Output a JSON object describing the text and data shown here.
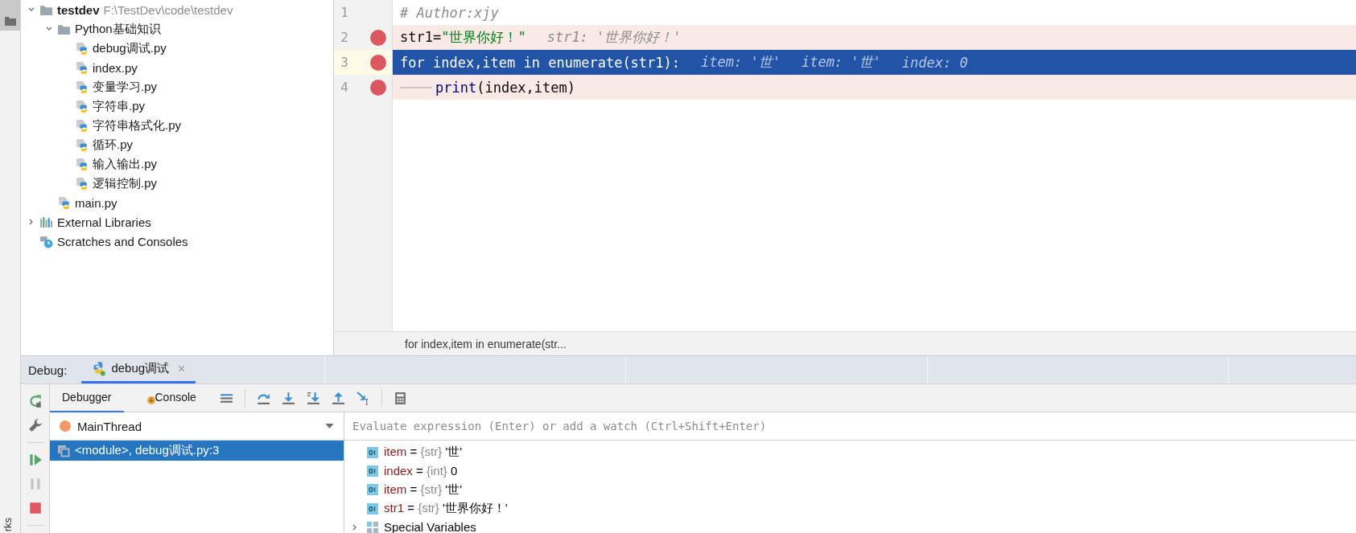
{
  "side_strip": {
    "label": "rks"
  },
  "project_tree": {
    "items": [
      {
        "label": "testdev",
        "path": "F:\\TestDev\\code\\testdev",
        "kind": "project",
        "expanded": true,
        "children": [
          {
            "label": "Python基础知识",
            "kind": "folder",
            "expanded": true,
            "children": [
              {
                "label": "debug调试.py",
                "kind": "file"
              },
              {
                "label": "index.py",
                "kind": "file"
              },
              {
                "label": "变量学习.py",
                "kind": "file"
              },
              {
                "label": "字符串.py",
                "kind": "file"
              },
              {
                "label": "字符串格式化.py",
                "kind": "file"
              },
              {
                "label": "循环.py",
                "kind": "file"
              },
              {
                "label": "输入输出.py",
                "kind": "file"
              },
              {
                "label": "逻辑控制.py",
                "kind": "file"
              }
            ]
          },
          {
            "label": "main.py",
            "kind": "file"
          }
        ]
      },
      {
        "label": "External Libraries",
        "kind": "libraries",
        "expanded": false
      },
      {
        "label": "Scratches and Consoles",
        "kind": "scratches"
      }
    ]
  },
  "editor": {
    "lines": [
      {
        "number": "1",
        "breakpoint": false,
        "current": false,
        "tokens": [
          {
            "text": "# Author:xjy",
            "kind": "comment"
          }
        ]
      },
      {
        "number": "2",
        "breakpoint": true,
        "current": false,
        "tokens": [
          {
            "text": "str1=",
            "kind": "plain"
          },
          {
            "text": "\"世界你好！\"",
            "kind": "string"
          }
        ],
        "hints": [
          "str1: '世界你好！'"
        ]
      },
      {
        "number": "3",
        "breakpoint": true,
        "current": true,
        "tokens": [
          {
            "text": "for",
            "kind": "keyword"
          },
          {
            "text": " index,item ",
            "kind": "plain"
          },
          {
            "text": "in",
            "kind": "keyword"
          },
          {
            "text": " enumerate(str1):",
            "kind": "plain"
          }
        ],
        "hints": [
          "item: '世'",
          "item: '世'",
          "index: 0"
        ]
      },
      {
        "number": "4",
        "breakpoint": true,
        "current": false,
        "indent": true,
        "tokens": [
          {
            "text": "print",
            "kind": "builtin"
          },
          {
            "text": "(index,item)",
            "kind": "plain"
          }
        ]
      }
    ],
    "breadcrumb": "for index,item in enumerate(str..."
  },
  "debug": {
    "title": "Debug:",
    "tabs": [
      {
        "label": "debug调试",
        "selected": true
      }
    ],
    "view_tabs": [
      {
        "label": "Debugger",
        "selected": true
      },
      {
        "label": "Console",
        "selected": false
      }
    ],
    "thread": "MainThread",
    "frames": [
      {
        "label": "<module>, debug调试.py:3",
        "selected": true
      }
    ],
    "evaluate": {
      "placeholder": "Evaluate expression (Enter) or add a watch (Ctrl+Shift+Enter)"
    },
    "variables": [
      {
        "kind": "value",
        "name": "item",
        "separator": "=",
        "type": "{str}",
        "value": "'世'"
      },
      {
        "kind": "value",
        "name": "index",
        "separator": "=",
        "type": "{int}",
        "value": "0"
      },
      {
        "kind": "value",
        "name": "item",
        "separator": "=",
        "type": "{str}",
        "value": "'世'"
      },
      {
        "kind": "value",
        "name": "str1",
        "separator": "=",
        "type": "{str}",
        "value": "'世界你好！'"
      },
      {
        "kind": "group",
        "name": "Special Variables",
        "expanded": false
      }
    ]
  }
}
